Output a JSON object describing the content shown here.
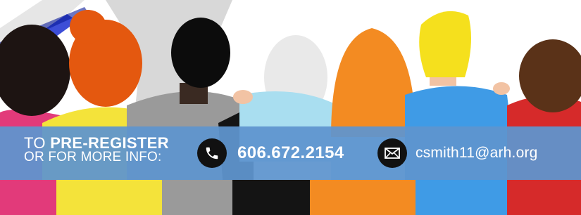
{
  "banner": {
    "cta_prefix": "TO",
    "cta_emphasis": "PRE-REGISTER",
    "cta_line2": "OR FOR MORE INFO:",
    "phone": "606.672.2154",
    "email": "csmith11@arh.org"
  },
  "icons": {
    "phone": "phone-icon",
    "email": "envelope-icon"
  },
  "colors": {
    "banner_background": "#5f95ce",
    "banner_text": "#ffffff",
    "icon_circle": "#111111"
  }
}
